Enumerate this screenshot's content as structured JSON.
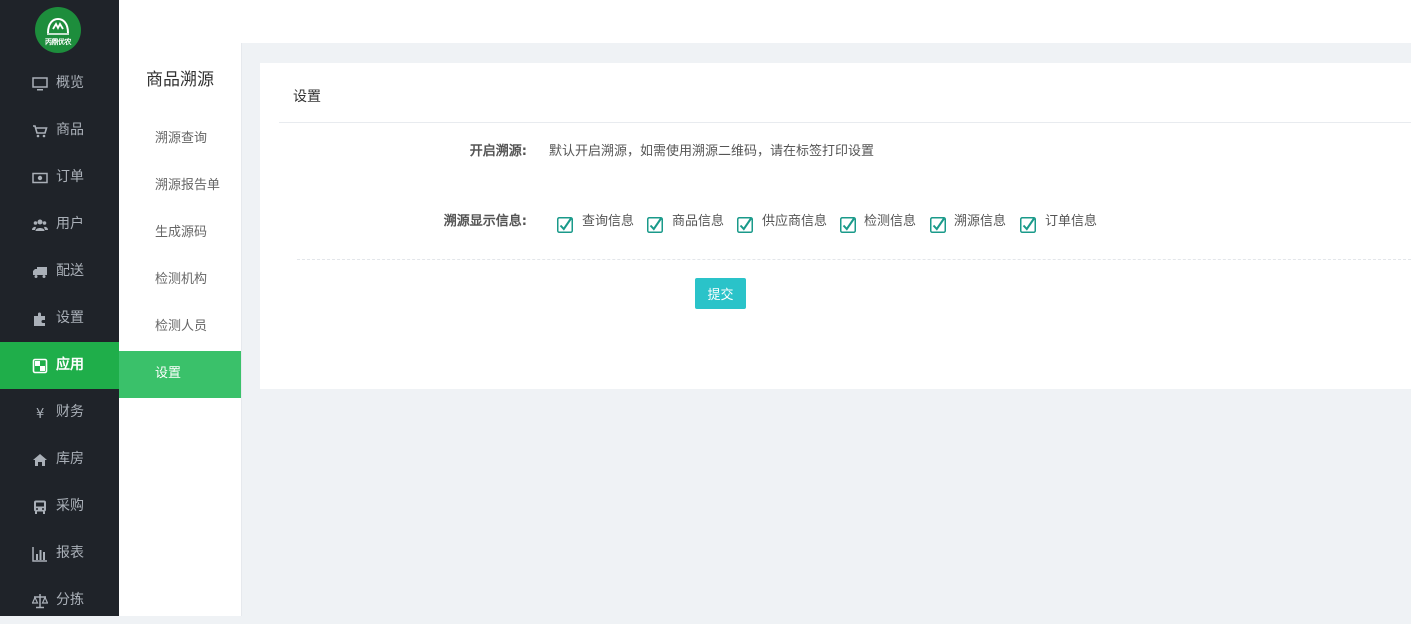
{
  "brand": {
    "logo_text": "丙鼎优农"
  },
  "sidebar": {
    "items": [
      {
        "label": "概览",
        "icon": "monitor-icon",
        "active": false
      },
      {
        "label": "商品",
        "icon": "cart-icon",
        "active": false
      },
      {
        "label": "订单",
        "icon": "money-icon",
        "active": false
      },
      {
        "label": "用户",
        "icon": "users-icon",
        "active": false
      },
      {
        "label": "配送",
        "icon": "truck-icon",
        "active": false
      },
      {
        "label": "设置",
        "icon": "puzzle-icon",
        "active": false
      },
      {
        "label": "应用",
        "icon": "apps-icon",
        "active": true
      },
      {
        "label": "财务",
        "icon": "yen-icon",
        "active": false
      },
      {
        "label": "库房",
        "icon": "home-icon",
        "active": false
      },
      {
        "label": "采购",
        "icon": "bus-icon",
        "active": false
      },
      {
        "label": "报表",
        "icon": "bar-chart-icon",
        "active": false
      },
      {
        "label": "分拣",
        "icon": "scale-icon",
        "active": false
      }
    ]
  },
  "subnav": {
    "title": "商品溯源",
    "items": [
      {
        "label": "溯源查询",
        "active": false
      },
      {
        "label": "溯源报告单",
        "active": false
      },
      {
        "label": "生成源码",
        "active": false
      },
      {
        "label": "检测机构",
        "active": false
      },
      {
        "label": "检测人员",
        "active": false
      },
      {
        "label": "设置",
        "active": true
      }
    ]
  },
  "panel": {
    "title": "设置",
    "trace_label": "开启溯源:",
    "trace_text": "默认开启溯源，如需使用溯源二维码，请在标签打印设置",
    "display_label": "溯源显示信息:",
    "checkboxes": [
      {
        "label": "查询信息",
        "checked": true
      },
      {
        "label": "商品信息",
        "checked": true
      },
      {
        "label": "供应商信息",
        "checked": true
      },
      {
        "label": "检测信息",
        "checked": true
      },
      {
        "label": "溯源信息",
        "checked": true
      },
      {
        "label": "订单信息",
        "checked": true
      }
    ],
    "submit_label": "提交"
  },
  "colors": {
    "sidebar_bg": "#1f2329",
    "sidebar_active": "#1fae4a",
    "subnav_active": "#3ac16a",
    "checkbox": "#1a9a8a",
    "submit_bg": "#2ac3c9"
  }
}
